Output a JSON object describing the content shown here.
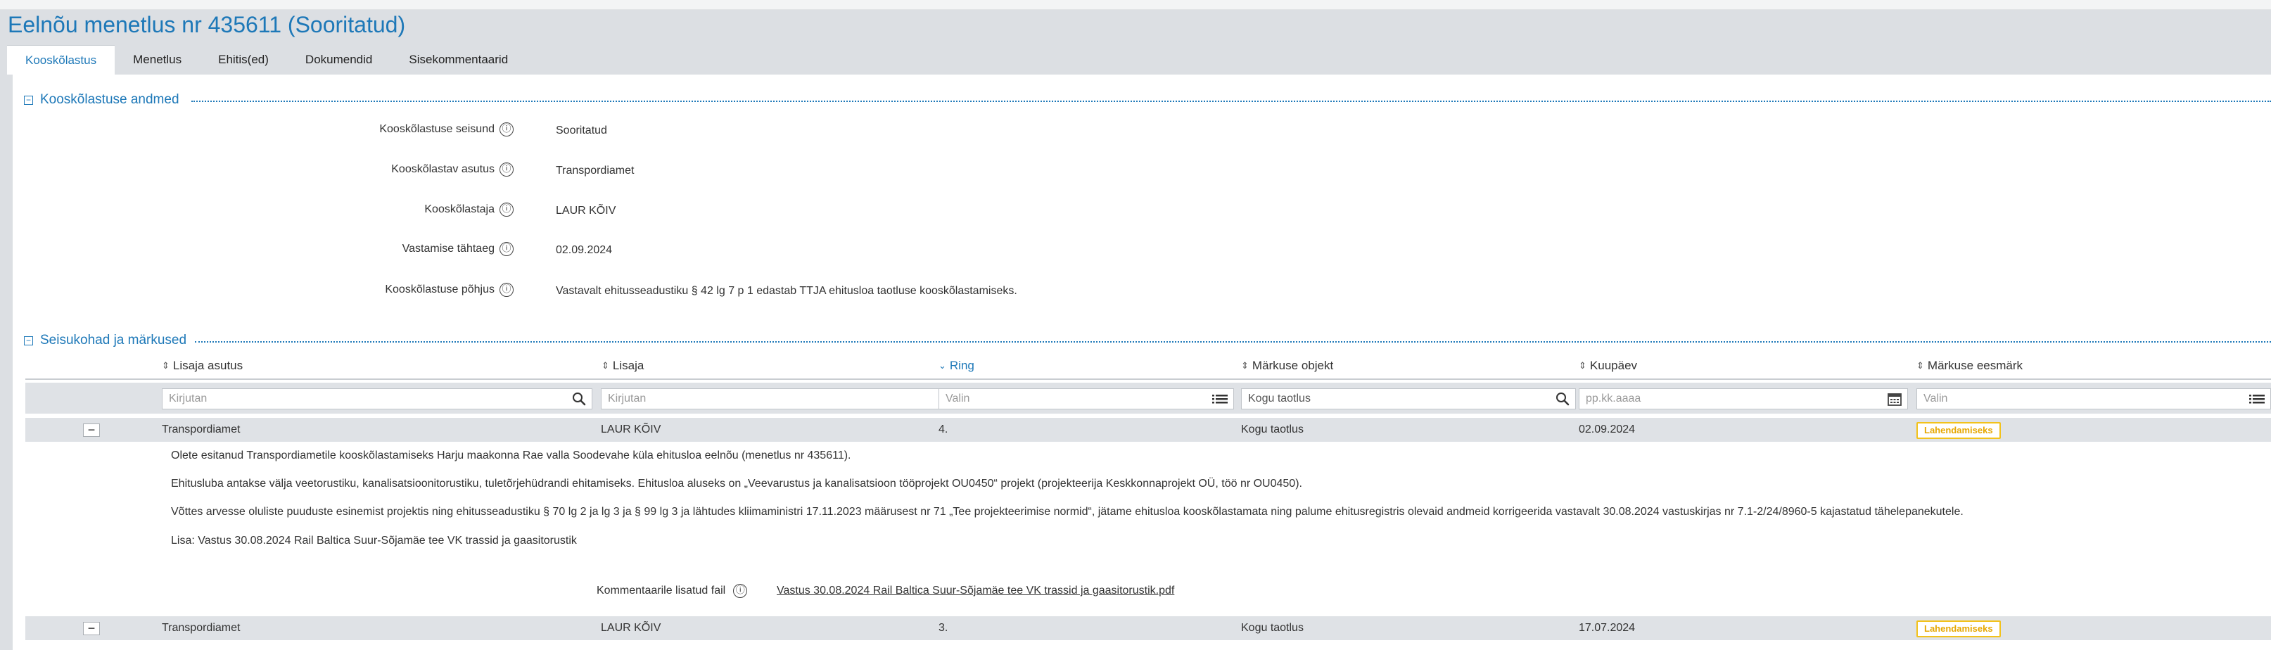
{
  "page": {
    "title": "Eelnõu menetlus nr 435611 (Sooritatud)"
  },
  "tabs": [
    {
      "label": "Kooskõlastus"
    },
    {
      "label": "Menetlus"
    },
    {
      "label": "Ehitis(ed)"
    },
    {
      "label": "Dokumendid"
    },
    {
      "label": "Sisekommentaarid"
    }
  ],
  "approval": {
    "section_title": "Kooskõlastuse andmed",
    "fields": [
      {
        "label": "Kooskõlastuse seisund",
        "value": "Sooritatud"
      },
      {
        "label": "Kooskõlastav asutus",
        "value": "Transpordiamet"
      },
      {
        "label": "Kooskõlastaja",
        "value": "LAUR KÕIV"
      },
      {
        "label": "Vastamise tähtaeg",
        "value": "02.09.2024"
      },
      {
        "label": "Kooskõlastuse põhjus",
        "value": "Vastavalt ehitusseadustiku § 42 lg 7 p 1 edastab TTJA ehitusloa taotluse kooskõlastamiseks."
      }
    ]
  },
  "remarks": {
    "section_title": "Seisukohad ja märkused",
    "columns": [
      {
        "label": "Lisaja asutus",
        "sort": "⇕"
      },
      {
        "label": "Lisaja",
        "sort": "⇕"
      },
      {
        "label": "Ring",
        "sort": "⌄"
      },
      {
        "label": "Märkuse objekt",
        "sort": "⇕"
      },
      {
        "label": "Kuupäev",
        "sort": "⇕"
      },
      {
        "label": "Märkuse eesmärk",
        "sort": "⇕"
      }
    ],
    "filters": [
      {
        "placeholder": "Kirjutan"
      },
      {
        "placeholder": "Kirjutan"
      },
      {
        "placeholder": "Valin"
      },
      {
        "value": "Kogu taotlus"
      },
      {
        "placeholder": "pp.kk.aaaa"
      },
      {
        "placeholder": "Valin"
      }
    ],
    "rows": [
      {
        "institution": "Transpordiamet",
        "author": "LAUR KÕIV",
        "round": "4.",
        "object": "Kogu taotlus",
        "date": "02.09.2024",
        "purpose": "Lahendamiseks",
        "paragraphs": [
          "Olete esitanud Transpordiametile kooskõlastamiseks Harju maakonna Rae valla Soodevahe küla ehitusloa eelnõu (menetlus nr 435611).",
          "Ehitusluba antakse välja veetorustiku, kanalisatsioonitorustiku, tuletõrjehüdrandi  ehitamiseks. Ehitusloa aluseks on „Veevarustus ja kanalisatsioon tööprojekt OU0450“ projekt (projekteerija Keskkonnaprojekt OÜ, töö nr OU0450).",
          "Võttes arvesse oluliste puuduste esinemist projektis ning ehitusseadustiku § 70 lg 2 ja lg 3 ja § 99 lg 3 ja lähtudes kliimaministri 17.11.2023 määrusest nr 71 „Tee projekteerimise normid“, jätame ehitusloa kooskõlastamata ning palume ehitusregistris olevaid andmeid korrigeerida vastavalt 30.08.2024 vastuskirjas nr 7.1-2/24/8960-5 kajastatud tähelepanekutele.",
          "Lisa: Vastus 30.08.2024 Rail Baltica Suur-Sõjamäe tee VK trassid ja gaasitorustik"
        ],
        "attachment_label": "Kommentaarile lisatud fail",
        "attachment_file": "Vastus 30.08.2024 Rail Baltica Suur-Sõjamäe tee VK trassid ja gaasitorustik.pdf"
      },
      {
        "institution": "Transpordiamet",
        "author": "LAUR KÕIV",
        "round": "3.",
        "object": "Kogu taotlus",
        "date": "17.07.2024",
        "purpose": "Lahendamiseks"
      }
    ]
  },
  "icons": {
    "info": "ⓘ",
    "search": "search-icon",
    "list": "list-icon",
    "calendar": "calendar-icon",
    "collapse": "−",
    "section_toggle": "−"
  },
  "colors": {
    "accent": "#1d78b8",
    "badge": "#f2c21b",
    "header_bg": "#dcdfe3"
  }
}
